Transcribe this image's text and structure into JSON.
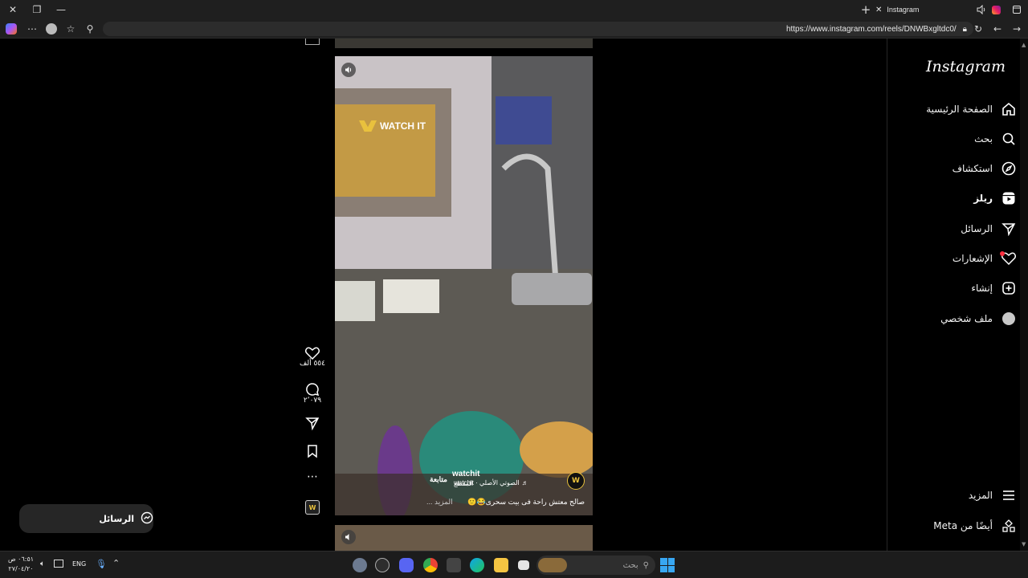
{
  "browser": {
    "tab_title": "Instagram",
    "url": "https://www.instagram.com/reels/DNWBxgltdc0/"
  },
  "sidebar": {
    "logo": "Instagram",
    "items": [
      {
        "label": "الصفحة الرئيسية",
        "icon": "home-icon"
      },
      {
        "label": "بحث",
        "icon": "search-icon"
      },
      {
        "label": "استكشاف",
        "icon": "compass-icon"
      },
      {
        "label": "ريلز",
        "icon": "reels-icon"
      },
      {
        "label": "الرسائل",
        "icon": "send-icon"
      },
      {
        "label": "الإشعارات",
        "icon": "heart-icon"
      },
      {
        "label": "إنشاء",
        "icon": "plus-icon"
      },
      {
        "label": "ملف شخصي",
        "icon": "avatar-icon"
      }
    ],
    "more_label": "المزيد",
    "meta_label": "أيضًا من Meta"
  },
  "reel": {
    "watermark": "WATCH IT",
    "username": "watchit",
    "follow_label": "متابعة",
    "audio_line": "الصوتي الأصلي · watchit",
    "audio_line_prefix": "♬",
    "audio_sub": "المقطع",
    "caption": "صالح معتش راحة فى بيت سحرى😂🙂",
    "caption_more": "... المزيد",
    "likes": "٥٥٤ ألف",
    "comments": "٢٬٠٧٩"
  },
  "messages_pill": {
    "label": "الرسائل"
  },
  "taskbar": {
    "search_placeholder": "بحث",
    "lang": "ENG",
    "time": "٠٦:٥١ ص",
    "date": "٢٧/٠٤/٢٠"
  },
  "colors": {
    "background": "#000000",
    "sidebar_border": "#262626",
    "notification_dot": "#ff3040"
  }
}
